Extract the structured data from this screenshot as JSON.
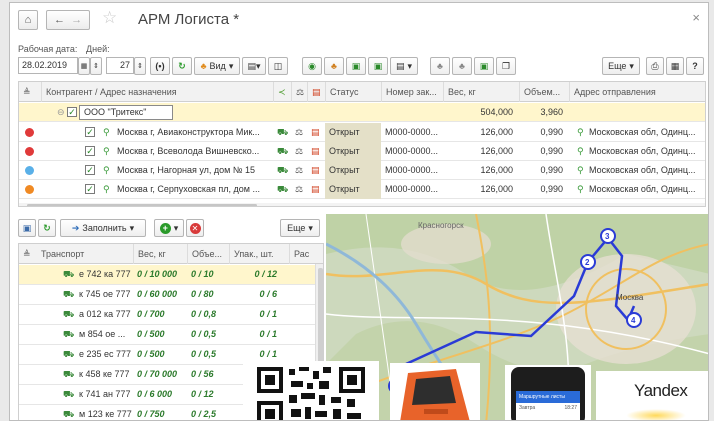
{
  "window": {
    "title": "АРМ Логиста *",
    "close_glyph": "×"
  },
  "filters": {
    "work_date_label": "Рабочая дата:",
    "work_date_value": "28.02.2019",
    "days_label": "Дней:",
    "days_value": "27",
    "view_button": "Вид",
    "more_button": "Еще",
    "help_button": "?"
  },
  "orders": {
    "columns": [
      "Контрагент / Адрес назначения",
      "Статус",
      "Номер зак...",
      "Вес, кг",
      "Объем...",
      "Адрес отправления"
    ],
    "group": {
      "name": "ООО \"Тритекс\"",
      "weight": "504,000",
      "volume": "3,960"
    },
    "rows": [
      {
        "dot": "#e03a3a",
        "address": "Москва г, Авиаконструктора Мик...",
        "status": "Открыт",
        "number": "М000-0000...",
        "weight": "126,000",
        "volume": "0,990",
        "from": "Московская обл, Одинц..."
      },
      {
        "dot": "#e03a3a",
        "address": "Москва г, Всеволода Вишневско...",
        "status": "Открыт",
        "number": "М000-0000...",
        "weight": "126,000",
        "volume": "0,990",
        "from": "Московская обл, Одинц..."
      },
      {
        "dot": "#5ab0e8",
        "address": "Москва г, Нагорная ул, дом № 15",
        "status": "Открыт",
        "number": "М000-0000...",
        "weight": "126,000",
        "volume": "0,990",
        "from": "Московская обл, Одинц..."
      },
      {
        "dot": "#f08a24",
        "address": "Москва г, Серпуховская пл, дом ...",
        "status": "Открыт",
        "number": "М000-0000...",
        "weight": "126,000",
        "volume": "0,990",
        "from": "Московская обл, Одинц..."
      }
    ]
  },
  "transport": {
    "fill_button": "Заполнить",
    "more_button": "Еще",
    "columns": [
      "Транспорт",
      "Вес, кг",
      "Объе...",
      "Упак., шт.",
      "Рас"
    ],
    "rows": [
      {
        "name": "е 742 ка 777",
        "weight": "0 / 10 000",
        "volume": "0 / 10",
        "packs": "0 / 12"
      },
      {
        "name": "к 745 ое 777",
        "weight": "0 / 60 000",
        "volume": "0 / 80",
        "packs": "0 / 6"
      },
      {
        "name": "а 012 ка 777",
        "weight": "0 / 700",
        "volume": "0 / 0,8",
        "packs": "0 / 1"
      },
      {
        "name": "м 854 ое ...",
        "weight": "0 / 500",
        "volume": "0 / 0,5",
        "packs": "0 / 1"
      },
      {
        "name": "е 235 ес 777",
        "weight": "0 / 500",
        "volume": "0 / 0,5",
        "packs": "0 / 1"
      },
      {
        "name": "к 458 ке 777",
        "weight": "0 / 70 000",
        "volume": "0 / 56",
        "packs": ""
      },
      {
        "name": "к 741 ан 777",
        "weight": "0 / 6 000",
        "volume": "0 / 12",
        "packs": ""
      },
      {
        "name": "м 123 ке 777",
        "weight": "0 / 750",
        "volume": "0 / 2,5",
        "packs": ""
      }
    ]
  },
  "map": {
    "labels": {
      "city_nw": "Красногорск",
      "city_center": "Москва"
    },
    "markers": [
      "1",
      "2",
      "3",
      "4"
    ]
  },
  "overlays": {
    "phone_header": "Маршрутные листы",
    "phone_row_left": "Завтра",
    "phone_row_right": "18:27",
    "yandex_text": "Yandex"
  },
  "colors": {
    "accent_green": "#3a9a3a",
    "route_blue": "#2a3bd6",
    "status_bg": "#e4e0c8",
    "selection_yellow": "#fff6cc"
  }
}
